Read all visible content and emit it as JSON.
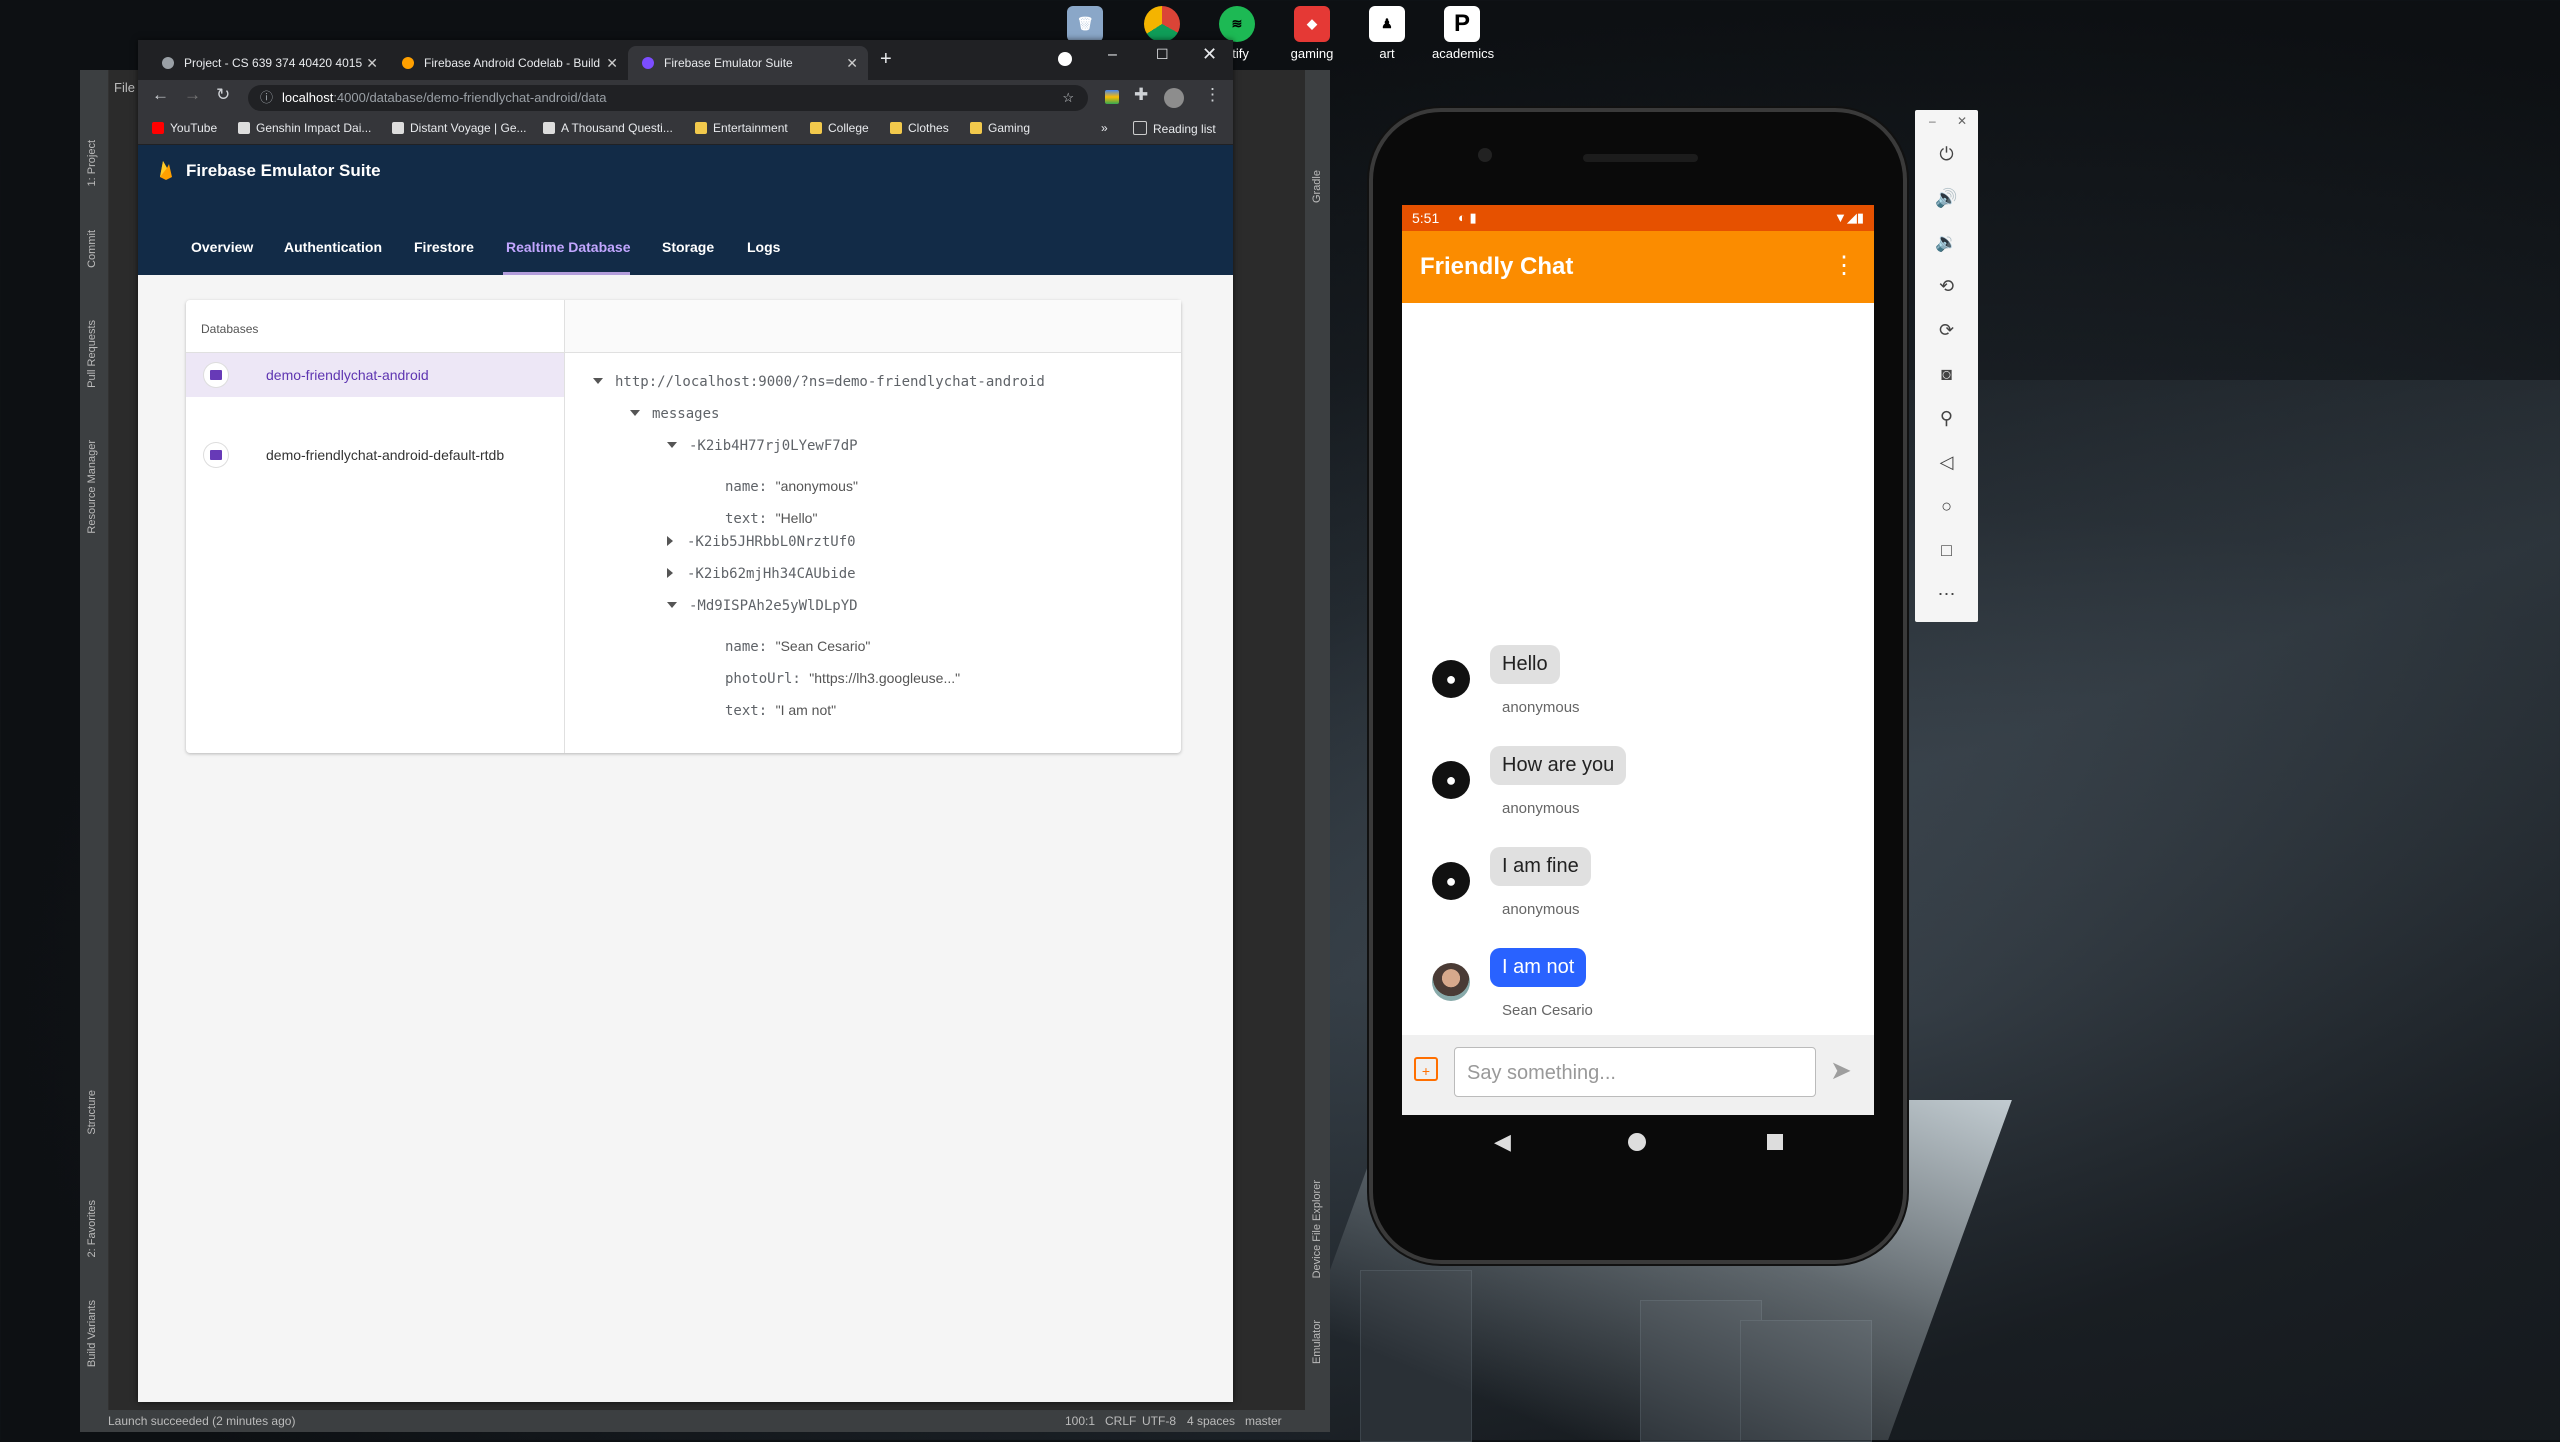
{
  "desktop": {
    "icons": [
      {
        "label": "",
        "icon": "recycle-bin-icon"
      },
      {
        "label": "",
        "icon": "chrome-icon"
      },
      {
        "label": "otify",
        "icon": "spotify-icon"
      },
      {
        "label": "gaming",
        "icon": "gaming-icon"
      },
      {
        "label": "art",
        "icon": "art-icon"
      },
      {
        "label": "academics",
        "icon": "academics-icon"
      }
    ]
  },
  "ide": {
    "menu": "File",
    "side_tabs": [
      "1: Project",
      "Commit",
      "Pull Requests",
      "Resource Manager",
      "Structure",
      "2: Favorites",
      "Build Variants"
    ],
    "right_tabs": [
      "Gradle",
      "Device File Explorer",
      "Emulator"
    ],
    "status_left": "Launch succeeded (2 minutes ago)",
    "status_right": [
      "100:1",
      "CRLF",
      "UTF-8",
      "4 spaces",
      "master"
    ]
  },
  "browser": {
    "tabs": [
      {
        "title": "Project - CS 639 374 40420 4015",
        "color": "#9aa0a6"
      },
      {
        "title": "Firebase Android Codelab - Build",
        "color": "#ffa000"
      },
      {
        "title": "Firebase Emulator Suite",
        "color": "#7c4dff"
      }
    ],
    "url_host": "localhost",
    "url_path": ":4000/database/demo-friendlychat-android/data",
    "bookmarks": [
      "YouTube",
      "Genshin Impact Dai...",
      "Distant Voyage | Ge...",
      "A Thousand Questi...",
      "Entertainment",
      "College",
      "Clothes",
      "Gaming"
    ],
    "reading_list": "Reading list",
    "more": "»"
  },
  "firebase": {
    "title": "Firebase Emulator Suite",
    "tabs": [
      "Overview",
      "Authentication",
      "Firestore",
      "Realtime Database",
      "Storage",
      "Logs"
    ],
    "active_tab": "Realtime Database",
    "databases_label": "Databases",
    "databases": [
      "demo-friendlychat-android",
      "demo-friendlychat-android-default-rtdb"
    ],
    "tree": {
      "root": "http://localhost:9000/?ns=demo-friendlychat-android",
      "messages": "messages",
      "nodes": [
        {
          "key": "-K2ib4H77rj0LYewF7dP",
          "expanded": true,
          "fields": [
            {
              "k": "name:",
              "v": "\"anonymous\""
            },
            {
              "k": "text:",
              "v": "\"Hello\""
            }
          ]
        },
        {
          "key": "-K2ib5JHRbbL0NrztUf0",
          "expanded": false,
          "fields": []
        },
        {
          "key": "-K2ib62mjHh34CAUbide",
          "expanded": false,
          "fields": []
        },
        {
          "key": "-Md9ISPAh2e5yWlDLpYD",
          "expanded": true,
          "fields": [
            {
              "k": "name:",
              "v": "\"Sean Cesario\""
            },
            {
              "k": "photoUrl:",
              "v": "\"https://lh3.googleuse...\""
            },
            {
              "k": "text:",
              "v": "\"I am not\""
            }
          ]
        }
      ]
    }
  },
  "phone": {
    "time": "5:51",
    "app_title": "Friendly Chat",
    "messages": [
      {
        "text": "Hello",
        "sender": "anonymous",
        "self": false
      },
      {
        "text": "How are you",
        "sender": "anonymous",
        "self": false
      },
      {
        "text": "I am fine",
        "sender": "anonymous",
        "self": false
      },
      {
        "text": "I am not",
        "sender": "Sean Cesario",
        "self": true
      }
    ],
    "input_placeholder": "Say something...",
    "colors": {
      "status": "#e65100",
      "appbar": "#fb8c00",
      "self_bubble": "#2962ff"
    }
  },
  "emulator_toolbar": [
    "power-icon",
    "volume-up-icon",
    "volume-down-icon",
    "rotate-left-icon",
    "rotate-right-icon",
    "camera-icon",
    "zoom-icon",
    "back-icon",
    "home-icon",
    "overview-icon",
    "more-icon"
  ]
}
